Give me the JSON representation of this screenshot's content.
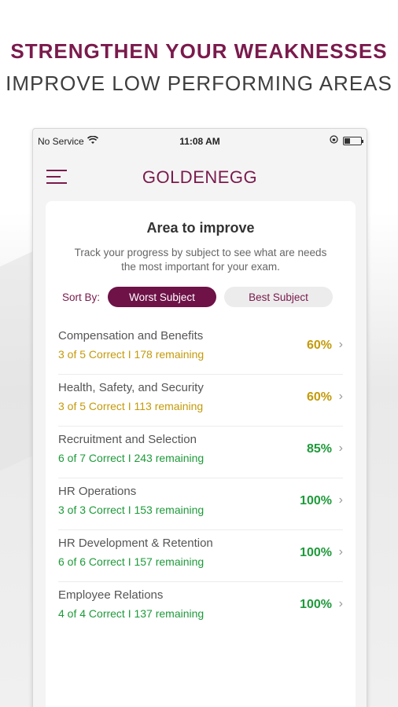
{
  "promo": {
    "headline": "STRENGTHEN YOUR WEAKNESSES",
    "subheadline": "IMPROVE LOW PERFORMING AREAS"
  },
  "statusbar": {
    "carrier": "No Service",
    "time": "11:08 AM",
    "battery_level": 0.3
  },
  "appbar": {
    "logo": "GOLDENEGG"
  },
  "card": {
    "title": "Area to improve",
    "description": "Track your progress by subject to see what are needs the most important for your exam.",
    "sort_label": "Sort By:",
    "sort_worst": "Worst Subject",
    "sort_best": "Best Subject"
  },
  "colors": {
    "brand": "#7a1a4c",
    "warn": "#c49a0a",
    "good": "#1e9a3a"
  },
  "subjects": [
    {
      "name": "Compensation and Benefits",
      "stats": "3 of 5  Correct I 178 remaining",
      "pct": "60%",
      "status": "warn"
    },
    {
      "name": "Health, Safety, and Security",
      "stats": "3 of 5  Correct I 113 remaining",
      "pct": "60%",
      "status": "warn"
    },
    {
      "name": "Recruitment and Selection",
      "stats": "6 of 7  Correct I 243 remaining",
      "pct": "85%",
      "status": "good"
    },
    {
      "name": "HR Operations",
      "stats": "3 of 3  Correct I 153 remaining",
      "pct": "100%",
      "status": "good"
    },
    {
      "name": "HR Development & Retention",
      "stats": "6 of 6  Correct I 157 remaining",
      "pct": "100%",
      "status": "good"
    },
    {
      "name": "Employee Relations",
      "stats": "4 of 4  Correct I 137 remaining",
      "pct": "100%",
      "status": "good"
    }
  ]
}
